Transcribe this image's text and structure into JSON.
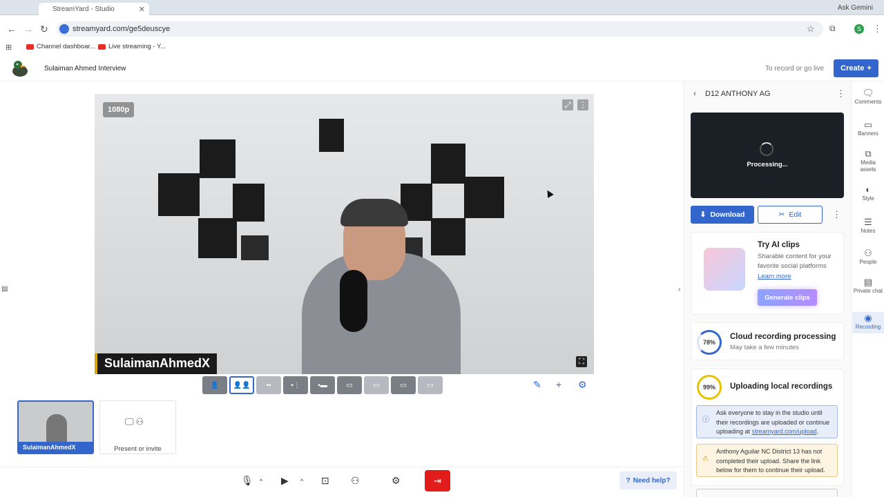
{
  "browser": {
    "tab_title": "StreamYard - Studio",
    "ask_gemini": "Ask Gemini",
    "url": "streamyard.com/ge5deuscye",
    "profile_initial": "S",
    "bookmarks": [
      "Channel dashboar...",
      "Live streaming - Y..."
    ]
  },
  "header": {
    "studio_title": "Sulaiman Ahmed Interview",
    "record_hint": "To record or go live",
    "create_label": "Create"
  },
  "stage": {
    "resolution_badge": "1080p",
    "name_banner": "SulaimanAhmedX"
  },
  "participants": {
    "thumb_name": "SulaimanAhmedX",
    "present_label": "Present or invite"
  },
  "bottombar": {
    "help_label": "Need help?"
  },
  "recording_panel": {
    "title": "D12 ANTHONY AG",
    "processing_text": "Processing...",
    "download_label": "Download",
    "edit_label": "Edit",
    "ai_clips": {
      "title": "Try AI clips",
      "description": "Sharable content for your favorite social platforms",
      "learn_more": "Learn more",
      "generate_label": "Generate clips"
    },
    "cloud": {
      "percent": "78%",
      "title": "Cloud recording processing",
      "subtitle": "May take a few minutes"
    },
    "local": {
      "percent": "99%",
      "title": "Uploading local recordings",
      "info_text": "Ask everyone to stay in the studio until their recordings are uploaded or continue uploading at",
      "info_link": "streamyard.com/upload",
      "info_suffix": ".",
      "warning_text": "Anthony Aguilar NC District 13 has not completed their upload. Share the link below for them to continue their upload."
    }
  },
  "rail": {
    "comments": "Comments",
    "banners": "Banners",
    "media_assets": "Media assets",
    "style": "Style",
    "notes": "Notes",
    "people": "People",
    "private_chat": "Private chat",
    "recording": "Recording"
  },
  "colors": {
    "accent": "#3366cc",
    "leave": "#e21b1b",
    "banner_stripe": "#d6a800"
  }
}
